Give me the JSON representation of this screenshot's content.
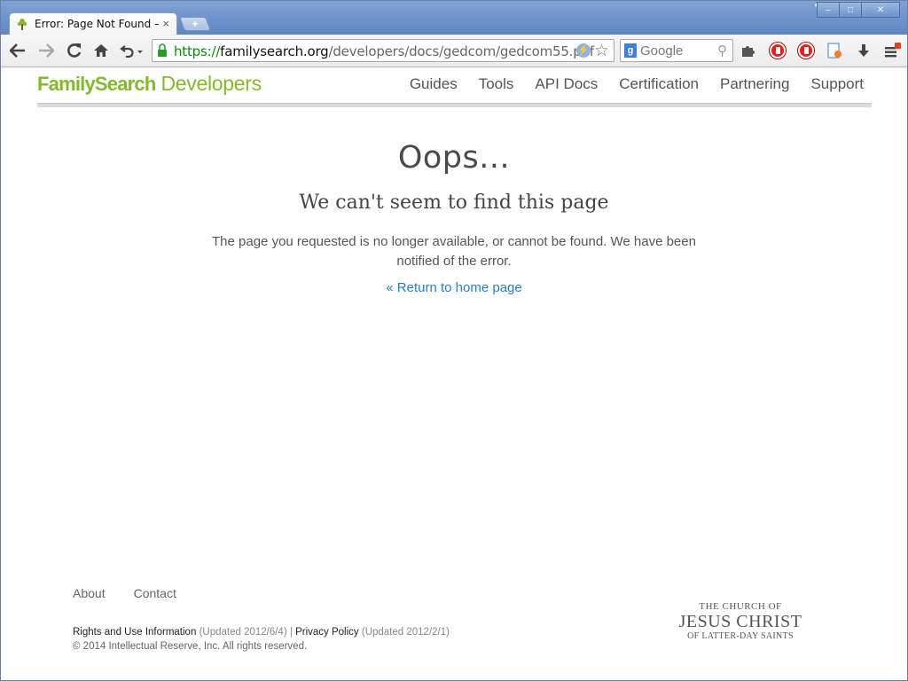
{
  "window": {
    "tab_title": "Error: Page Not Found —",
    "tab_close": "×",
    "new_tab": "+",
    "controls": {
      "minimize": "‒",
      "maximize": "□",
      "close": "✕"
    }
  },
  "toolbar": {
    "url_scheme": "https://",
    "url_host": "familysearch.org",
    "url_path": "/developers/docs/gedcom/gedcom55.pdf",
    "search_placeholder": "Google"
  },
  "site": {
    "logo_brand": "FamilySearch",
    "logo_suffix": "Developers",
    "nav": [
      "Guides",
      "Tools",
      "API Docs",
      "Certification",
      "Partnering",
      "Support"
    ]
  },
  "error": {
    "heading": "Oops...",
    "subheading": "We can't seem to find this page",
    "message": "The page you requested is no longer available, or cannot be found. We have been notified of the error.",
    "return_link": "« Return to home page"
  },
  "footer": {
    "links": [
      "About",
      "Contact"
    ],
    "rights_label": "Rights and Use Information",
    "rights_updated": "(Updated 2012/6/4)",
    "separator": "|",
    "privacy_label": "Privacy Policy",
    "privacy_updated": "(Updated 2012/2/1)",
    "copyright": "© 2014 Intellectual Reserve, Inc. All rights reserved.",
    "church_line1": "THE CHURCH OF",
    "church_line2": "JESUS CHRIST",
    "church_line3": "OF LATTER-DAY SAINTS"
  },
  "colors": {
    "brand_green": "#86b82d",
    "link_blue": "#2a7fc2",
    "chrome_blue": "#6f95cf"
  }
}
